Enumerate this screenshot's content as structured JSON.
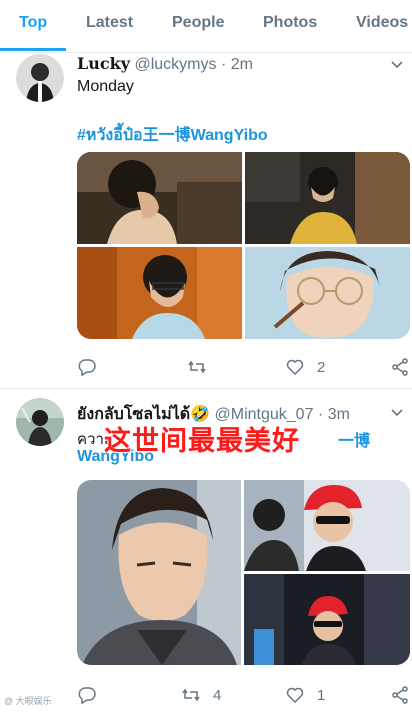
{
  "tabs": [
    "Top",
    "Latest",
    "People",
    "Photos",
    "Videos"
  ],
  "active_tab": "Top",
  "colors": {
    "accent": "#1da1f2",
    "hashtag": "#1b95e0",
    "muted": "#657786",
    "overlay": "#ff1a1a"
  },
  "tweets": [
    {
      "name": "Lucky",
      "handle": "@luckymys",
      "time": "2m",
      "text": "Monday",
      "hashtag": "#หวังอี้ป๋อ王一博WangYibo",
      "actions": {
        "reply": "",
        "retweet": "",
        "like": "2",
        "share": ""
      },
      "icons": [
        "reply-icon",
        "retweet-icon",
        "heart-icon",
        "share-icon",
        "chevron-down-icon"
      ]
    },
    {
      "name": "ยังกลับโซลไม่ได้🤣",
      "handle": "@Mintguk_07",
      "time": "3m",
      "text": "ความ...",
      "hashtag_tail": "一博",
      "hashtag_line2": "WangYibo",
      "overlay_text": "这世间最最美好",
      "actions": {
        "reply": "",
        "retweet": "4",
        "like": "1",
        "share": ""
      },
      "icons": [
        "reply-icon",
        "retweet-icon",
        "heart-icon",
        "share-icon",
        "chevron-down-icon"
      ]
    }
  ],
  "watermark": "@ 大眼娱乐"
}
